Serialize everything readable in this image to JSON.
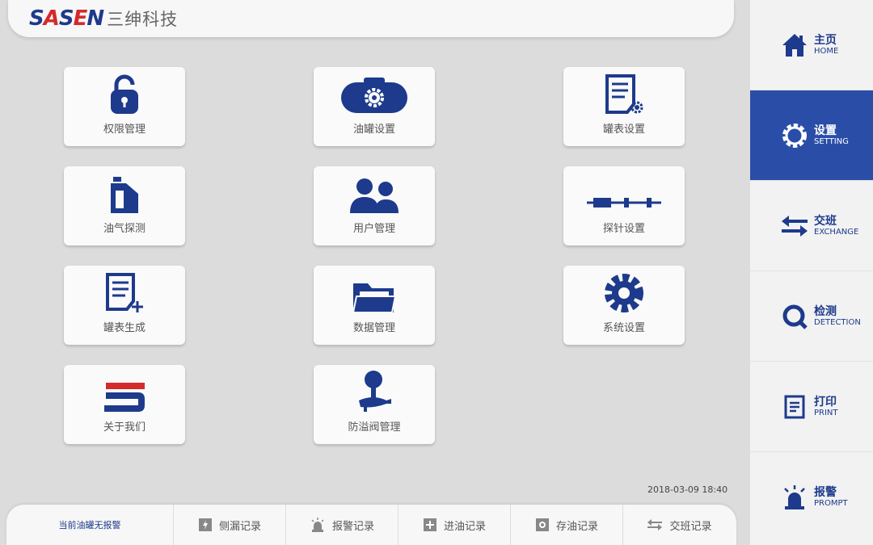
{
  "header": {
    "logo_text": "SASEN",
    "logo_cn": "三绅科技"
  },
  "tiles": [
    {
      "label": "权限管理",
      "icon": "unlock-icon"
    },
    {
      "label": "油罐设置",
      "icon": "tank-settings-icon"
    },
    {
      "label": "罐表设置",
      "icon": "tank-table-settings-icon"
    },
    {
      "label": "油气探测",
      "icon": "fuel-can-icon"
    },
    {
      "label": "用户管理",
      "icon": "users-icon"
    },
    {
      "label": "探针设置",
      "icon": "probe-icon"
    },
    {
      "label": "罐表生成",
      "icon": "document-add-icon"
    },
    {
      "label": "数据管理",
      "icon": "folder-icon"
    },
    {
      "label": "系统设置",
      "icon": "gear-icon"
    },
    {
      "label": "关于我们",
      "icon": "sasen-logo-icon"
    },
    {
      "label": "防溢阀管理",
      "icon": "valve-icon"
    }
  ],
  "sidebar": {
    "items": [
      {
        "cn": "主页",
        "en": "HOME",
        "icon": "home-icon",
        "active": false
      },
      {
        "cn": "设置",
        "en": "SETTING",
        "icon": "gear-icon",
        "active": true
      },
      {
        "cn": "交班",
        "en": "EXCHANGE",
        "icon": "exchange-icon",
        "active": false
      },
      {
        "cn": "检测",
        "en": "DETECTION",
        "icon": "detection-icon",
        "active": false
      },
      {
        "cn": "打印",
        "en": "PRINT",
        "icon": "print-icon",
        "active": false
      },
      {
        "cn": "报警",
        "en": "PROMPT",
        "icon": "alarm-icon",
        "active": false
      }
    ]
  },
  "timestamp": "2018-03-09 18:40",
  "bottombar": {
    "status": "当前油罐无报警",
    "items": [
      {
        "label": "侧漏记录",
        "icon": "leak-icon"
      },
      {
        "label": "报警记录",
        "icon": "alarm-icon"
      },
      {
        "label": "进油记录",
        "icon": "plus-box-icon"
      },
      {
        "label": "存油记录",
        "icon": "storage-icon"
      },
      {
        "label": "交班记录",
        "icon": "exchange-icon"
      }
    ]
  },
  "colors": {
    "primary": "#1d3a8c",
    "active": "#2a4ea8",
    "logo_red": "#d42a2a",
    "background": "#dcdcdc"
  }
}
